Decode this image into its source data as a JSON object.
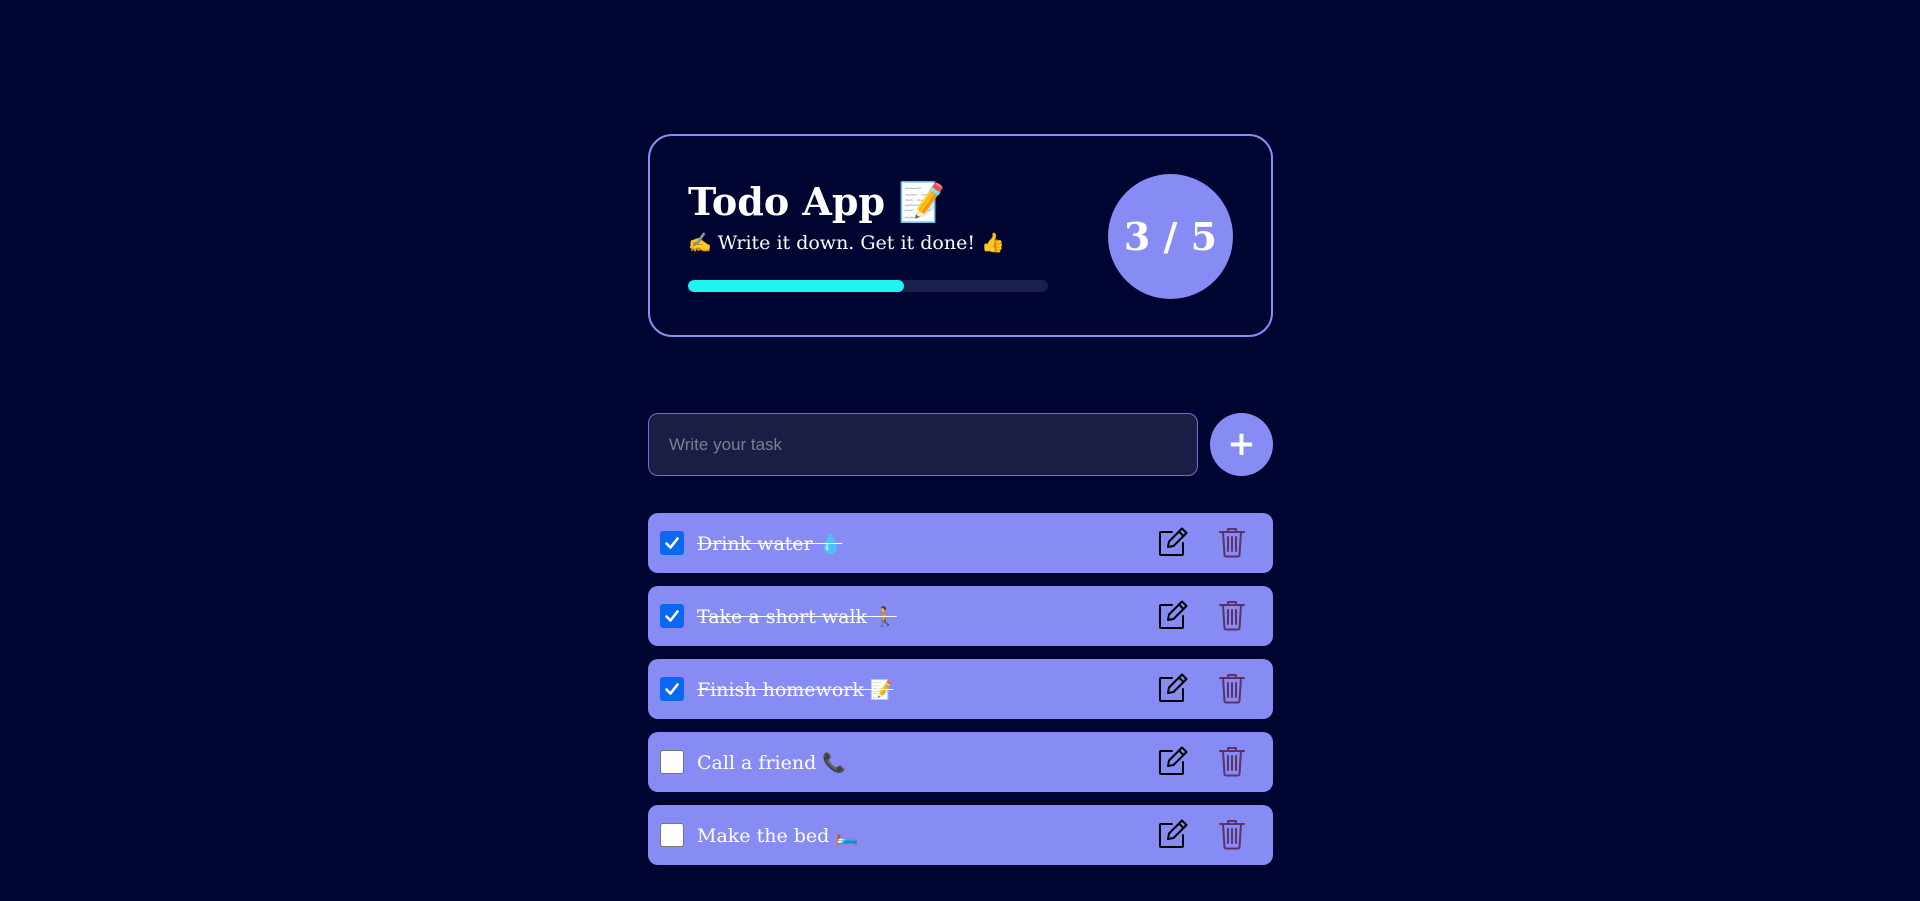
{
  "header": {
    "title": "Todo App 📝",
    "subtitle": "✍️ Write it down. Get it done! 👍",
    "completed": 3,
    "total": 5,
    "count_text": "3 / 5",
    "progress_fraction": 0.6
  },
  "form": {
    "placeholder": "Write your task",
    "add_label": "+"
  },
  "tasks": [
    {
      "text": "Drink water 💧",
      "done": true
    },
    {
      "text": "Take a short walk 🚶",
      "done": true
    },
    {
      "text": "Finish homework 📝",
      "done": true
    },
    {
      "text": "Call a friend 📞",
      "done": false
    },
    {
      "text": "Make the bed 🛏️",
      "done": false
    }
  ],
  "icons": {
    "edit": "edit-icon",
    "delete": "trash-icon",
    "check": "check-icon"
  },
  "colors": {
    "background": "#000430",
    "accent": "#878cf5",
    "progress": "#1ff4ef",
    "checkbox_checked": "#0b69f1",
    "delete_icon": "#5a3368"
  }
}
